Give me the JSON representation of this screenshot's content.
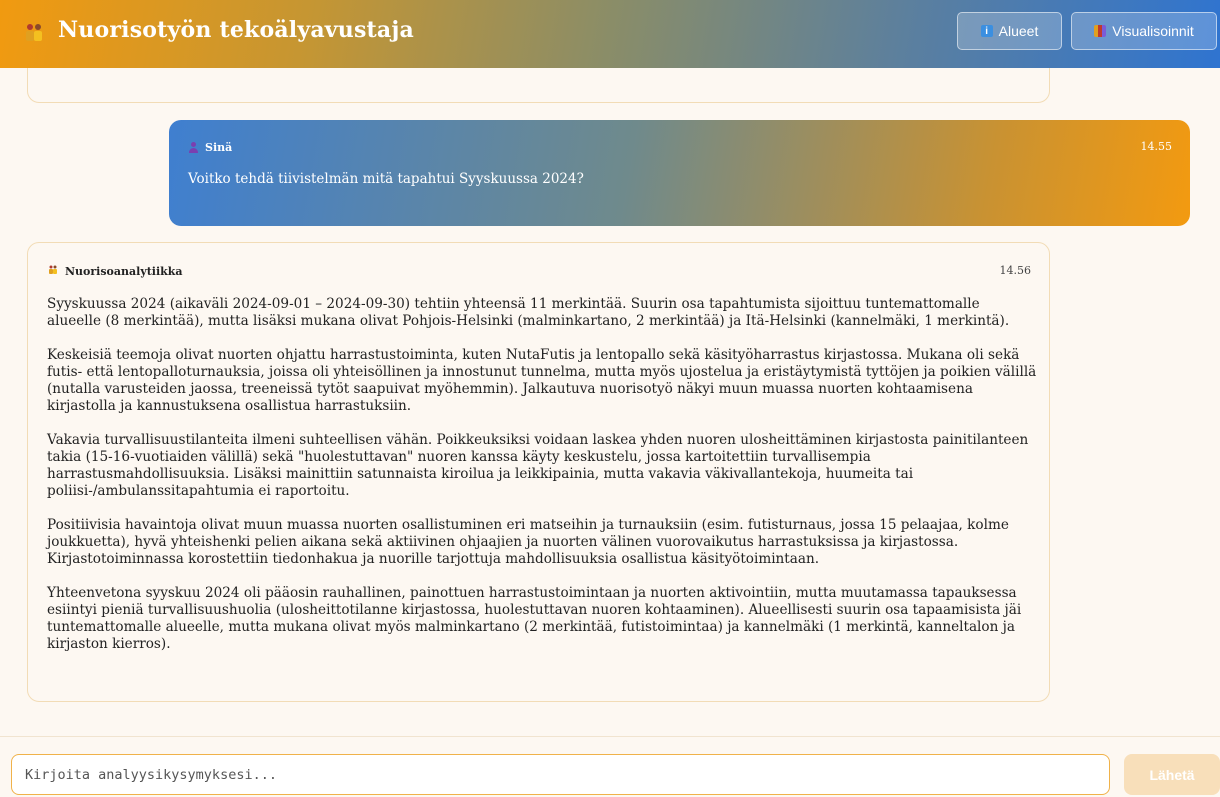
{
  "header": {
    "logo_icon": "team-figures-icon",
    "title": "Nuorisotyön tekoälyavustaja",
    "buttons": [
      {
        "label": "Alueet",
        "icon": "info-icon",
        "icon_glyph": "i"
      },
      {
        "label": "Visualisoinnit",
        "icon": "bar-chart-icon"
      }
    ]
  },
  "chat": {
    "user_message": {
      "sender": "Sinä",
      "time": "14.55",
      "text": "Voitko tehdä tiivistelmän mitä tapahtui Syyskuussa 2024?"
    },
    "bot_message": {
      "sender": "Nuorisoanalytiikka",
      "time": "14.56",
      "paragraphs": [
        "Syyskuussa 2024 (aikaväli 2024-09-01 – 2024-09-30) tehtiin yhteensä 11 merkintää. Suurin osa tapahtumista sijoittuu tuntemattomalle alueelle (8 merkintää), mutta lisäksi mukana olivat Pohjois-Helsinki (malminkartano, 2 merkintää) ja Itä-Helsinki (kannelmäki, 1 merkintä).",
        "Keskeisiä teemoja olivat nuorten ohjattu harrastustoiminta, kuten NutaFutis ja lentopallo sekä käsityöharrastus kirjastossa. Mukana oli sekä futis- että lentopalloturnauksia, joissa oli yhteisöllinen ja innostunut tunnelma, mutta myös ujostelua ja eristäytymistä tyttöjen ja poikien välillä (nutalla varusteiden jaossa, treeneissä tytöt saapuivat myöhemmin). Jalkautuva nuorisotyö näkyi muun muassa nuorten kohtaamisena kirjastolla ja kannustuksena osallistua harrastuksiin.",
        "Vakavia turvallisuustilanteita ilmeni suhteellisen vähän. Poikkeuksiksi voidaan laskea yhden nuoren ulosheittäminen kirjastosta painitilanteen takia (15-16-vuotiaiden välillä) sekä \"huolestuttavan\" nuoren kanssa käyty keskustelu, jossa kartoitettiin turvallisempia harrastusmahdollisuuksia. Lisäksi mainittiin satunnaista kiroilua ja leikkipainia, mutta vakavia väkivallantekoja, huumeita tai poliisi-/ambulanssitapahtumia ei raportoitu.",
        "Positiivisia havaintoja olivat muun muassa nuorten osallistuminen eri matseihin ja turnauksiin (esim. futisturnaus, jossa 15 pelaajaa, kolme joukkuetta), hyvä yhteishenki pelien aikana sekä aktiivinen ohjaajien ja nuorten välinen vuorovaikutus harrastuksissa ja kirjastossa. Kirjastotoiminnassa korostettiin tiedonhakua ja nuorille tarjottuja mahdollisuuksia osallistua käsityötoimintaan.",
        "Yhteenvetona syyskuu 2024 oli pääosin rauhallinen, painottuen harrastustoimintaan ja nuorten aktivointiin, mutta muutamassa tapauksessa esiintyi pieniä turvallisuushuolia (ulosheittotilanne kirjastossa, huolestuttavan nuoren kohtaaminen). Alueellisesti suurin osa tapaamisista jäi tuntemattomalle alueelle, mutta mukana olivat myös malminkartano (2 merkintää, futistoimintaa) ja kannelmäki (1 merkintä, kanneltalon ja kirjaston kierros)."
      ]
    }
  },
  "input": {
    "placeholder": "Kirjoita analyysikysymyksesi...",
    "value": "",
    "send_label": "Lähetä"
  },
  "colors": {
    "header_start": "#f19a10",
    "header_end": "#2f74d0",
    "accent": "#f0b24a",
    "send_disabled": "#f8dfba"
  }
}
